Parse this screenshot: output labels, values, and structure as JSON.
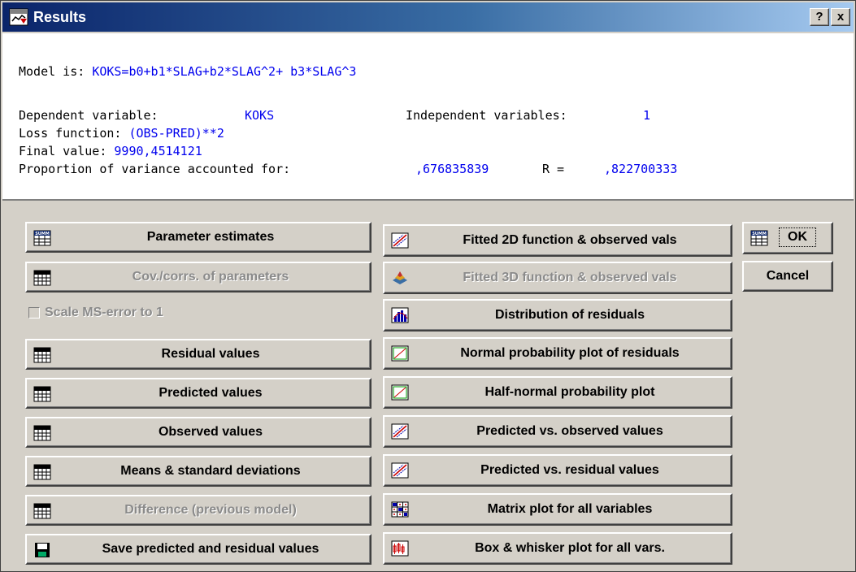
{
  "window": {
    "title": "Results",
    "help_label": "?",
    "close_label": "x"
  },
  "output": {
    "model_label": "Model is: ",
    "model_value": "KOKS=b0+b1*SLAG+b2*SLAG^2+ b3*SLAG^3",
    "dependent_label": "Dependent variable:",
    "dependent_value": "KOKS",
    "independent_label": "Independent variables:",
    "independent_value": "1",
    "loss_label": "Loss function: ",
    "loss_value": "(OBS-PRED)**2",
    "final_label": "Final value: ",
    "final_value": "9990,4514121",
    "proportion_label": "Proportion of variance accounted for:",
    "proportion_value": ",676835839",
    "r_label": "R =",
    "r_value": ",822700333"
  },
  "left_buttons": [
    {
      "label": "Parameter estimates",
      "icon": "summary-icon",
      "enabled": true
    },
    {
      "label": "Cov./corrs. of parameters",
      "icon": "spreadsheet-icon",
      "enabled": false
    },
    {
      "label": "Residual values",
      "icon": "spreadsheet-icon",
      "enabled": true
    },
    {
      "label": "Predicted values",
      "icon": "spreadsheet-icon",
      "enabled": true
    },
    {
      "label": "Observed values",
      "icon": "spreadsheet-icon",
      "enabled": true
    },
    {
      "label": "Means & standard deviations",
      "icon": "spreadsheet-icon",
      "enabled": true
    },
    {
      "label": "Difference (previous model)",
      "icon": "spreadsheet-icon",
      "enabled": false
    },
    {
      "label": "Save predicted and residual values",
      "icon": "floppy-disk-icon",
      "enabled": true
    }
  ],
  "scale_checkbox": {
    "label": "Scale MS-error to 1",
    "checked": false,
    "enabled": false
  },
  "right_buttons": [
    {
      "label": "Fitted 2D function & observed vals",
      "icon": "scatterplot-icon",
      "enabled": true
    },
    {
      "label": "Fitted 3D function & observed vals",
      "icon": "surface-plot-icon",
      "enabled": false
    },
    {
      "label": "Distribution of residuals",
      "icon": "histogram-icon",
      "enabled": true
    },
    {
      "label": "Normal probability plot of residuals",
      "icon": "probability-plot-icon",
      "enabled": true
    },
    {
      "label": "Half-normal probability plot",
      "icon": "probability-plot-icon",
      "enabled": true
    },
    {
      "label": "Predicted vs. observed values",
      "icon": "scatterplot-icon",
      "enabled": true
    },
    {
      "label": "Predicted vs. residual values",
      "icon": "scatterplot-icon",
      "enabled": true
    },
    {
      "label": "Matrix plot for all variables",
      "icon": "matrix-plot-icon",
      "enabled": true
    },
    {
      "label": "Box & whisker plot for all vars.",
      "icon": "box-whisker-icon",
      "enabled": true
    }
  ],
  "ok_button": {
    "label": "OK",
    "icon": "summary-icon"
  },
  "cancel_button": {
    "label": "Cancel"
  }
}
